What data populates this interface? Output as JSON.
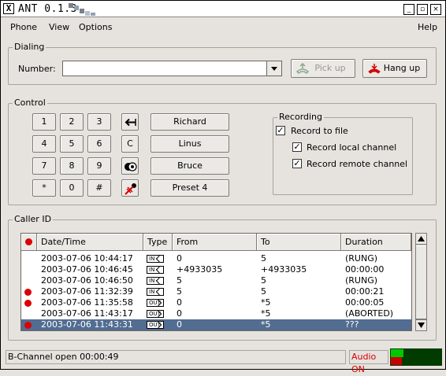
{
  "window": {
    "title": "ANT 0.1.3",
    "close_glyph": "X",
    "minimize_glyph": "_",
    "maximize_glyph": "▫",
    "close2_glyph": "×"
  },
  "menu": {
    "phone": "Phone",
    "view": "View",
    "options": "Options",
    "help": "Help"
  },
  "dialing": {
    "label": "Dialing",
    "number_label": "Number:",
    "number_value": "",
    "pickup_label": "Pick up",
    "hangup_label": "Hang up"
  },
  "control": {
    "label": "Control",
    "keys": [
      "1",
      "2",
      "3",
      "4",
      "5",
      "6",
      "7",
      "8",
      "9",
      "*",
      "0",
      "#"
    ],
    "special": {
      "backspace_icon": "backspace-arrow-icon",
      "clear": "C",
      "stop_icon": "speaker-icon",
      "mute_icon": "red-marker-icon"
    },
    "presets": [
      "Richard",
      "Linus",
      "Bruce",
      "Preset 4"
    ]
  },
  "recording": {
    "label": "Recording",
    "record_to_file": "Record to file",
    "record_local": "Record local channel",
    "record_remote": "Record remote channel",
    "checked": {
      "to_file": true,
      "local": true,
      "remote": true
    },
    "check_glyph": "✓"
  },
  "callerid": {
    "label": "Caller ID",
    "columns": {
      "datetime": "Date/Time",
      "type": "Type",
      "from": "From",
      "to": "To",
      "duration": "Duration"
    },
    "rows": [
      {
        "marked": false,
        "datetime": "2003-07-06 10:44:17",
        "type": "IN",
        "from": "0",
        "to": "5",
        "duration": "(RUNG)",
        "selected": false
      },
      {
        "marked": false,
        "datetime": "2003-07-06 10:46:45",
        "type": "IN",
        "from": "+4933035",
        "to": "+4933035",
        "duration": "00:00:00",
        "selected": false
      },
      {
        "marked": false,
        "datetime": "2003-07-06 10:46:50",
        "type": "IN",
        "from": "5",
        "to": "5",
        "duration": "(RUNG)",
        "selected": false
      },
      {
        "marked": true,
        "datetime": "2003-07-06 11:32:39",
        "type": "IN",
        "from": "5",
        "to": "5",
        "duration": "00:00:21",
        "selected": false
      },
      {
        "marked": true,
        "datetime": "2003-07-06 11:35:58",
        "type": "OUT",
        "from": "0",
        "to": "*5",
        "duration": "00:00:05",
        "selected": false
      },
      {
        "marked": false,
        "datetime": "2003-07-06 11:43:17",
        "type": "OUT",
        "from": "0",
        "to": "*5",
        "duration": "(ABORTED)",
        "selected": false
      },
      {
        "marked": true,
        "datetime": "2003-07-06 11:43:31",
        "type": "OUT",
        "from": "0",
        "to": "*5",
        "duration": "???",
        "selected": true
      }
    ]
  },
  "status": {
    "text": "B-Channel open 00:00:49",
    "audio": "Audio ON"
  },
  "colors": {
    "marker": "#dc0000",
    "selection": "#526d91",
    "meter_green": "#00c800",
    "meter_red": "#c80000",
    "meter_bg": "#003b00"
  },
  "meter": {
    "in_level": 0.25,
    "out_level": 0.22
  }
}
